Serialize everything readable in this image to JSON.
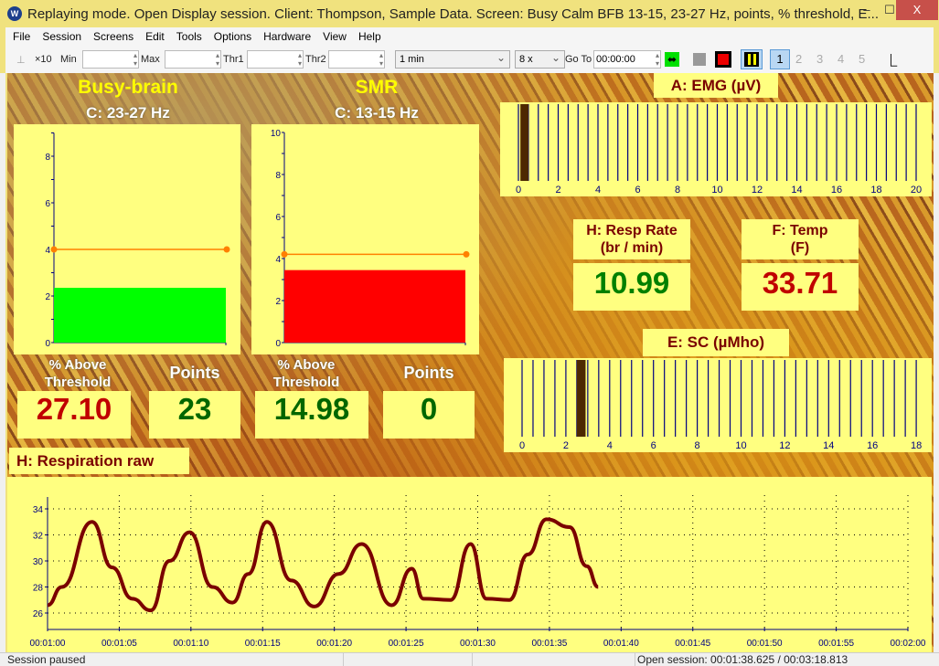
{
  "window": {
    "title": "Replaying mode. Open Display session. Client: Thompson, Sample Data. Screen: Busy Calm BFB 13-15, 23-27 Hz, points, % threshold, E...",
    "minimize": "–",
    "maximize": "☐",
    "close": "X"
  },
  "menu": [
    "File",
    "Session",
    "Screens",
    "Edit",
    "Tools",
    "Options",
    "Hardware",
    "View",
    "Help"
  ],
  "toolbar": {
    "x10": "×10",
    "min": "Min",
    "max": "Max",
    "thr1": "Thr1",
    "thr2": "Thr2",
    "timespan": "1 min",
    "speed": "8 x",
    "goto": "Go To",
    "goto_value": "00:00:00",
    "pages": [
      "1",
      "2",
      "3",
      "4",
      "5"
    ]
  },
  "busy": {
    "title": "Busy-brain",
    "subtitle": "C: 23-27 Hz",
    "value": 2.35,
    "threshold": 4,
    "ymax": 9,
    "ticks": [
      0,
      2,
      4,
      6,
      8
    ],
    "bar_color": "#00ff00",
    "pct_label": "% Above Threshold",
    "pct": "27.10",
    "points_label": "Points",
    "points": "23"
  },
  "smr": {
    "title": "SMR",
    "subtitle": "C: 13-15 Hz",
    "value": 3.45,
    "threshold": 4.2,
    "ymax": 10,
    "ticks": [
      0,
      2,
      4,
      6,
      8,
      10
    ],
    "bar_color": "#ff0000",
    "pct_label": "% Above Threshold",
    "pct": "14.98",
    "points_label": "Points",
    "points": "0"
  },
  "emg": {
    "label": "A: EMG (µV)",
    "value_start": 0.1,
    "value": 0.5,
    "max": 20,
    "ticks": [
      0,
      2,
      4,
      6,
      8,
      10,
      12,
      14,
      16,
      18,
      20
    ]
  },
  "resp_rate": {
    "label1": "H: Resp Rate",
    "label2": "(br / min)",
    "value": "10.99"
  },
  "temp": {
    "label1": "F: Temp",
    "label2": "(F)",
    "value": "33.71"
  },
  "sc": {
    "label": "E: SC (µMho)",
    "value_start": 2.5,
    "value": 2.9,
    "max": 18,
    "ticks": [
      0,
      2,
      4,
      6,
      8,
      10,
      12,
      14,
      16,
      18
    ]
  },
  "chart_data": {
    "type": "line",
    "title": "H: Respiration raw",
    "ylim": [
      25,
      35
    ],
    "yticks": [
      26,
      28,
      30,
      32,
      34
    ],
    "xticks": [
      "00:01:00",
      "00:01:05",
      "00:01:10",
      "00:01:15",
      "00:01:20",
      "00:01:25",
      "00:01:30",
      "00:01:35",
      "00:01:40",
      "00:01:45",
      "00:01:50",
      "00:01:55",
      "00:02:00"
    ],
    "x_seconds": [
      0,
      1,
      3.1,
      4.5,
      5.9,
      7.2,
      8.5,
      9.9,
      11.5,
      12.9,
      14,
      15.3,
      17,
      18.6,
      20.3,
      21.9,
      24,
      25.4,
      26.2,
      28.1,
      29.5,
      30.6,
      32.2,
      33.5,
      34.8,
      36.4,
      37.6,
      38.4
    ],
    "y": [
      26.6,
      28,
      33,
      29.5,
      27.1,
      26.2,
      30,
      32.2,
      28,
      26.8,
      29,
      33,
      28.5,
      26.5,
      29,
      31.3,
      26.6,
      29.4,
      27.1,
      27,
      31.3,
      27.1,
      27,
      30.5,
      33.2,
      32.6,
      29.6,
      28
    ]
  },
  "status": {
    "left": "Session paused",
    "right": "Open session: 00:01:38.625 / 00:03:18.813"
  }
}
